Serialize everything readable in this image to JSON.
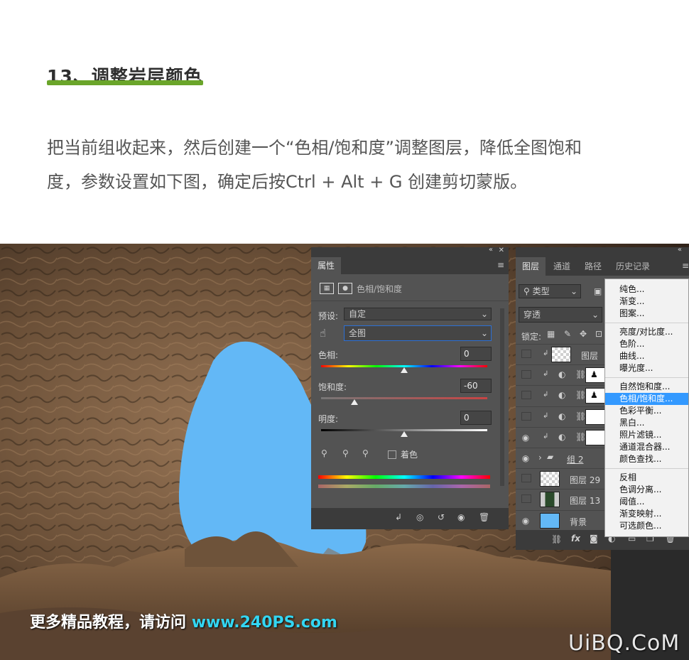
{
  "article": {
    "heading": "13、调整岩层颜色",
    "paragraph_line1": "把当前组收起来，然后创建一个“色相/饱和度”调整图层，降低全图饱和",
    "paragraph_line2": "度，参数设置如下图，确定后按Ctrl + Alt + G 创建剪切蒙版。"
  },
  "properties_panel": {
    "tab_label": "属性",
    "title": "色相/饱和度",
    "preset_label": "预设:",
    "preset_value": "自定",
    "channel_value": "全图",
    "hue_label": "色相:",
    "hue_value": "0",
    "hue_fraction": 0.5,
    "saturation_label": "饱和度:",
    "saturation_value": "-60",
    "saturation_fraction": 0.2,
    "lightness_label": "明度:",
    "lightness_value": "0",
    "lightness_fraction": 0.5,
    "colorize_label": "着色",
    "colorize_checked": false
  },
  "layers_panel": {
    "tabs": [
      "图层",
      "通道",
      "路径",
      "历史记录"
    ],
    "filter_label": "类型",
    "blend_mode": "穿透",
    "lock_label": "锁定:",
    "layers": [
      {
        "name": "图层",
        "visible": false,
        "kind": "checker"
      },
      {
        "name": "",
        "visible": false,
        "kind": "adjust-mask"
      },
      {
        "name": "",
        "visible": false,
        "kind": "adjust-mask"
      },
      {
        "name": "",
        "visible": false,
        "kind": "adjust-white"
      },
      {
        "name": "",
        "visible": true,
        "kind": "adjust-white"
      },
      {
        "name": "组 2",
        "visible": true,
        "kind": "group"
      },
      {
        "name": "图层 29",
        "visible": false,
        "kind": "checker"
      },
      {
        "name": "图层 13",
        "visible": false,
        "kind": "image"
      },
      {
        "name": "背景",
        "visible": true,
        "kind": "blue"
      }
    ]
  },
  "adjust_menu": {
    "groups": [
      [
        "纯色...",
        "渐变...",
        "图案..."
      ],
      [
        "亮度/对比度...",
        "色阶...",
        "曲线...",
        "曝光度..."
      ],
      [
        "自然饱和度...",
        "色相/饱和度...",
        "色彩平衡...",
        "黑白...",
        "照片滤镜...",
        "通道混合器...",
        "颜色查找..."
      ],
      [
        "反相",
        "色调分离...",
        "阈值...",
        "渐变映射...",
        "可选颜色..."
      ]
    ],
    "selected": "色相/饱和度..."
  },
  "watermark": {
    "promo_text": "更多精品教程，请访问",
    "promo_url": "www.240PS.com",
    "logo_text": "UiBQ.CoM"
  },
  "colors": {
    "sky": "#63b8f6",
    "rock_dark": "#3a2c21",
    "rock_light": "#8a6a4d",
    "ps_panel": "#535353",
    "menu_highlight": "#3399ff",
    "accent_green": "#6aa52a",
    "url_cyan": "#33d6f2"
  }
}
